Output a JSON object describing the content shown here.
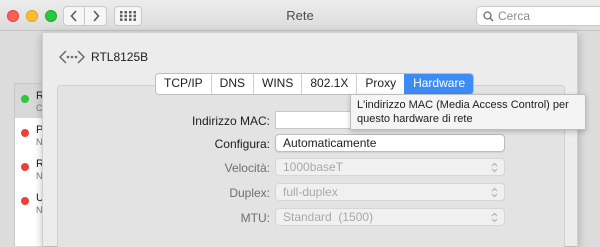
{
  "window": {
    "title": "Rete",
    "search_placeholder": "Cerca"
  },
  "services": [
    {
      "name": "R",
      "status": "C",
      "status_color": "#2fc73b",
      "selected": true
    },
    {
      "name": "P",
      "status": "N",
      "status_color": "#e9413a",
      "selected": false
    },
    {
      "name": "R",
      "status": "N",
      "status_color": "#e9413a",
      "selected": false
    },
    {
      "name": "U",
      "status": "N",
      "status_color": "#e9413a",
      "selected": false
    }
  ],
  "sheet": {
    "device_name": "RTL8125B",
    "tabs": [
      {
        "label": "TCP/IP",
        "active": false
      },
      {
        "label": "DNS",
        "active": false
      },
      {
        "label": "WINS",
        "active": false
      },
      {
        "label": "802.1X",
        "active": false
      },
      {
        "label": "Proxy",
        "active": false
      },
      {
        "label": "Hardware",
        "active": true
      }
    ],
    "fields": {
      "mac_label": "Indirizzo MAC:",
      "mac_value": "",
      "configura_label": "Configura:",
      "configura_value": "Automaticamente",
      "velocita_label": "Velocità:",
      "velocita_value": "1000baseT",
      "duplex_label": "Duplex:",
      "duplex_value": "full-duplex",
      "mtu_label": "MTU:",
      "mtu_value": "Standard  (1500)"
    },
    "tooltip": "L'indirizzo MAC (Media Access Control) per questo hardware di rete"
  },
  "colors": {
    "accent": "#3d8cf5",
    "connected": "#2fc73b",
    "disconnected": "#e9413a"
  }
}
